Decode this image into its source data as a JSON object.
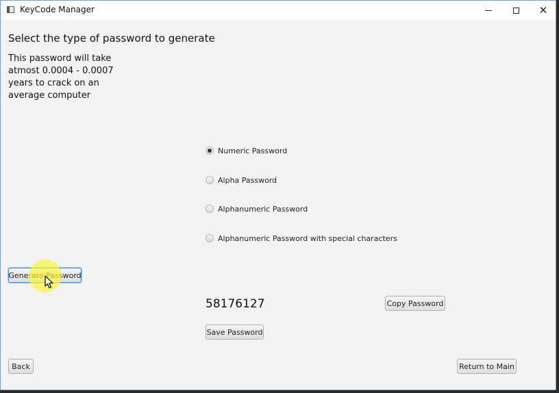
{
  "window": {
    "title": "KeyCode Manager",
    "icon": "app-window-icon",
    "controls": {
      "minimize_icon": "minimize-icon",
      "maximize_icon": "maximize-icon",
      "close_icon": "close-icon"
    }
  },
  "main": {
    "heading": "Select the type of password to generate",
    "crack_time_text": "This password will take atmost 0.0004 - 0.0007 years to crack on an average computer"
  },
  "password_types": {
    "selected": "Numeric Password",
    "options": [
      {
        "label": "Numeric Password",
        "selected": true
      },
      {
        "label": "Alpha Password",
        "selected": false
      },
      {
        "label": "Alphanumeric Password",
        "selected": false
      },
      {
        "label": "Alphanumeric Password with special characters",
        "selected": false
      }
    ]
  },
  "buttons": {
    "generate": "Generate Password",
    "copy": "Copy Password",
    "save": "Save Password",
    "back": "Back",
    "return_main": "Return to Main"
  },
  "generated_password": "58176127",
  "colors": {
    "window_background": "#f3f3f3",
    "focus_border": "#3d8ee0",
    "cursor_highlight": "#faf53c"
  }
}
